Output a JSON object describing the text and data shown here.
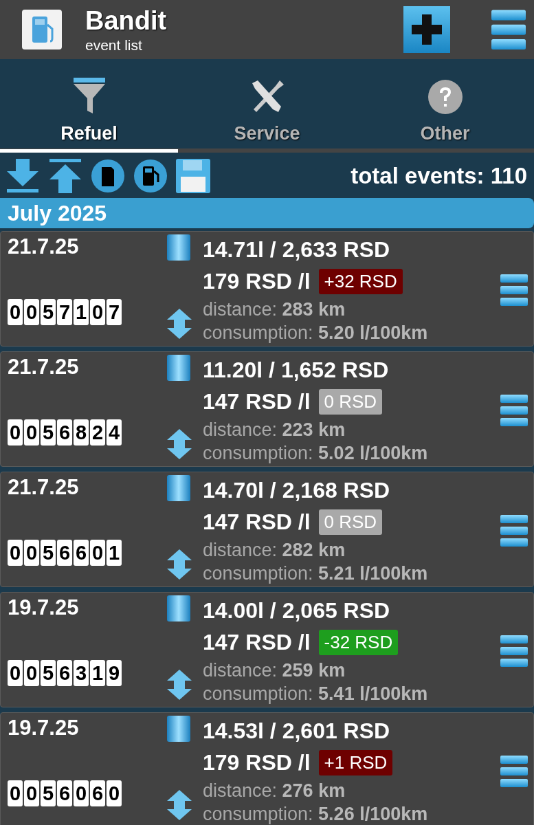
{
  "app": {
    "title": "Bandit",
    "subtitle": "event list"
  },
  "tabs": [
    {
      "label": "Refuel",
      "kind": "funnel",
      "selected": true
    },
    {
      "label": "Service",
      "kind": "tools",
      "selected": false
    },
    {
      "label": "Other",
      "kind": "question",
      "selected": false
    }
  ],
  "toolbar": {
    "total": "total events: 110"
  },
  "month": "July 2025",
  "events": [
    {
      "date": "21.7.25",
      "odometer": "0057107",
      "amount": "14.71l / 2,633 RSD",
      "price": "179 RSD /l",
      "diff": "+32 RSD",
      "color": "#6e0000",
      "distance": "distance: **283 km**",
      "consumption": "consumption: **5.20 l/100km**"
    },
    {
      "date": "21.7.25",
      "odometer": "0056824",
      "amount": "11.20l / 1,652 RSD",
      "price": "147 RSD /l",
      "diff": "0 RSD",
      "color": "#a9a9a9",
      "distance": "distance: **223 km**",
      "consumption": "consumption: **5.02 l/100km**"
    },
    {
      "date": "21.7.25",
      "odometer": "0056601",
      "amount": "14.70l / 2,168 RSD",
      "price": "147 RSD /l",
      "diff": "0 RSD",
      "color": "#a9a9a9",
      "distance": "distance: **282 km**",
      "consumption": "consumption: **5.21 l/100km**"
    },
    {
      "date": "19.7.25",
      "odometer": "0056319",
      "amount": "14.00l / 2,065 RSD",
      "price": "147 RSD /l",
      "diff": "-32 RSD",
      "color": "#1e9e1e",
      "distance": "distance: **259 km**",
      "consumption": "consumption: **5.41 l/100km**"
    },
    {
      "date": "19.7.25",
      "odometer": "0056060",
      "amount": "14.53l / 2,601 RSD",
      "price": "179 RSD /l",
      "diff": "+1 RSD",
      "color": "#6e0000",
      "distance": "distance: **276 km**",
      "consumption": "consumption: **5.26 l/100km**"
    }
  ]
}
